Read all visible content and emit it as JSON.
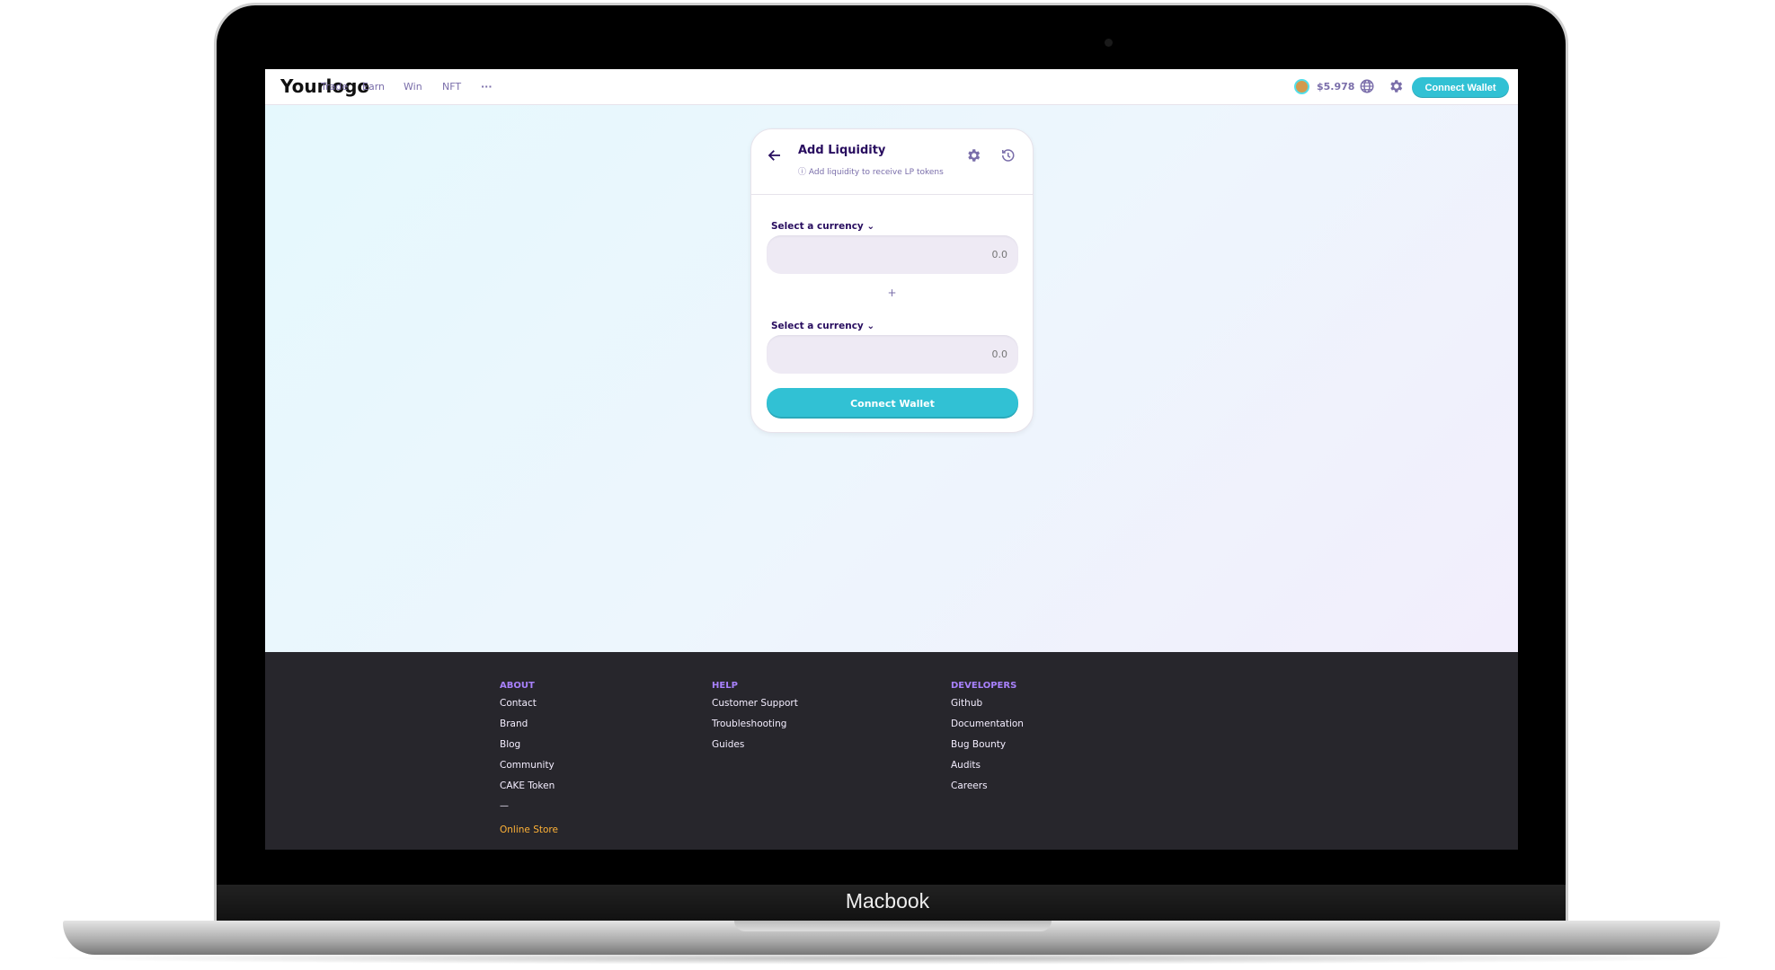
{
  "device": {
    "brand_label": "Macbook"
  },
  "header": {
    "logo": "Yourlogo",
    "nav": [
      "Trade",
      "Earn",
      "Win",
      "NFT",
      "···"
    ],
    "price": "$5.978",
    "connect_label": "Connect Wallet"
  },
  "card": {
    "title": "Add Liquidity",
    "subtitle": "Add liquidity to receive LP tokens",
    "select_label_a": "Select a currency",
    "amount_a_placeholder": "0.0",
    "plus": "+",
    "select_label_b": "Select a currency",
    "amount_b_placeholder": "0.0",
    "connect_label": "Connect Wallet"
  },
  "footer": {
    "about": {
      "heading": "ABOUT",
      "links": [
        "Contact",
        "Brand",
        "Blog",
        "Community",
        "CAKE Token"
      ],
      "divider": "—",
      "store": "Online Store"
    },
    "help": {
      "heading": "HELP",
      "links": [
        "Customer Support",
        "Troubleshooting",
        "Guides"
      ]
    },
    "developers": {
      "heading": "DEVELOPERS",
      "links": [
        "Github",
        "Documentation",
        "Bug Bounty",
        "Audits",
        "Careers"
      ]
    }
  },
  "colors": {
    "primary": "#31c1d4",
    "text": "#280d5f",
    "secondary": "#7a6eaa",
    "footer_heading": "#a881fc",
    "store": "#ffb237",
    "footer_bg": "#27262c"
  }
}
